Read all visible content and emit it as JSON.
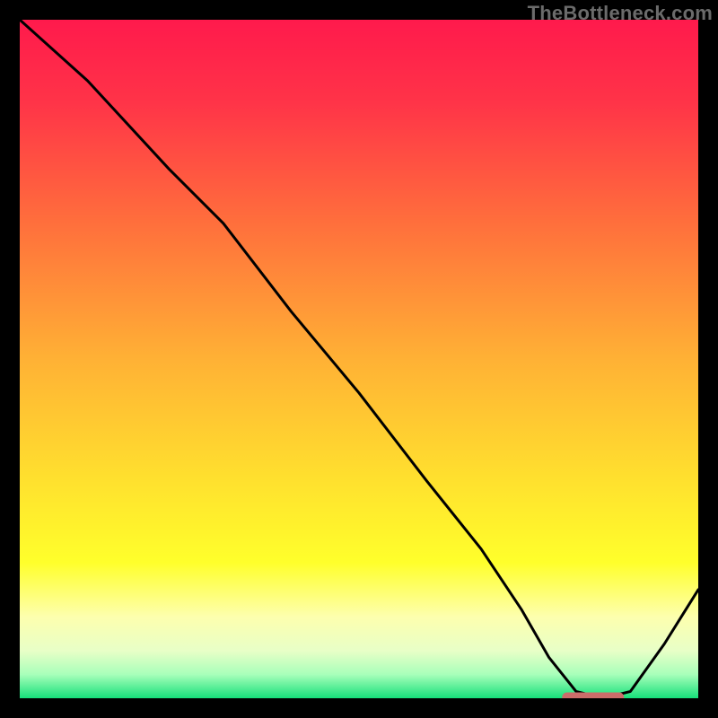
{
  "watermark": "TheBottleneck.com",
  "colors": {
    "frame": "#000000",
    "line": "#000000",
    "marker_fill": "#cc6d6a",
    "marker_stroke": "#cc6d6a",
    "gradient_stops": [
      {
        "offset": 0.0,
        "color": "#ff1a4c"
      },
      {
        "offset": 0.12,
        "color": "#ff3348"
      },
      {
        "offset": 0.3,
        "color": "#ff6f3c"
      },
      {
        "offset": 0.5,
        "color": "#ffb135"
      },
      {
        "offset": 0.68,
        "color": "#ffe12e"
      },
      {
        "offset": 0.8,
        "color": "#ffff2b"
      },
      {
        "offset": 0.88,
        "color": "#fdffae"
      },
      {
        "offset": 0.93,
        "color": "#e8ffc7"
      },
      {
        "offset": 0.965,
        "color": "#a8ffba"
      },
      {
        "offset": 1.0,
        "color": "#16e07a"
      }
    ]
  },
  "chart_data": {
    "type": "line",
    "title": "",
    "xlabel": "",
    "ylabel": "",
    "xlim": [
      0,
      100
    ],
    "ylim": [
      0,
      100
    ],
    "grid": false,
    "legend": false,
    "series": [
      {
        "name": "curve",
        "x": [
          0,
          10,
          22,
          30,
          40,
          50,
          60,
          68,
          74,
          78,
          82,
          86,
          90,
          95,
          100
        ],
        "y": [
          100,
          91,
          78,
          70,
          57,
          45,
          32,
          22,
          13,
          6,
          1,
          0,
          1,
          8,
          16
        ]
      }
    ],
    "optimum_marker": {
      "x_range": [
        80,
        89
      ],
      "y": 0
    }
  }
}
